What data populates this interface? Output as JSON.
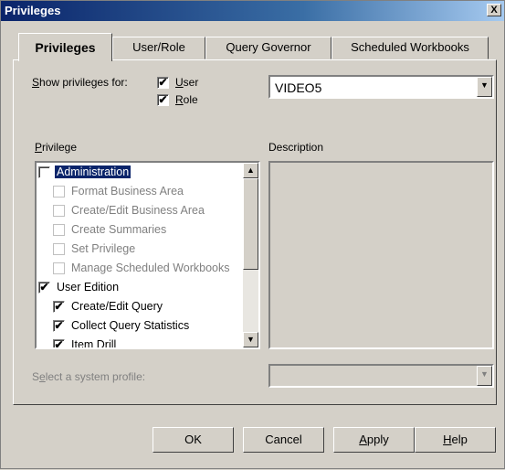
{
  "window": {
    "title": "Privileges",
    "close_label": "X"
  },
  "tabs": [
    {
      "label": "Privileges"
    },
    {
      "label": "User/Role"
    },
    {
      "label": "Query Governor"
    },
    {
      "label": "Scheduled Workbooks"
    }
  ],
  "show_for": {
    "label": "Show privileges for:",
    "user_label": "User",
    "user_checked": true,
    "role_label": "Role",
    "role_checked": true
  },
  "user_combo": {
    "value": "VIDEO5"
  },
  "privilege_list": {
    "label": "Privilege",
    "items": [
      {
        "label": "Administration",
        "checked": false,
        "indent": 0,
        "disabled": false,
        "selected": true
      },
      {
        "label": "Format Business Area",
        "checked": false,
        "indent": 1,
        "disabled": true,
        "selected": false
      },
      {
        "label": "Create/Edit Business Area",
        "checked": false,
        "indent": 1,
        "disabled": true,
        "selected": false
      },
      {
        "label": "Create Summaries",
        "checked": false,
        "indent": 1,
        "disabled": true,
        "selected": false
      },
      {
        "label": "Set Privilege",
        "checked": false,
        "indent": 1,
        "disabled": true,
        "selected": false
      },
      {
        "label": "Manage Scheduled Workbooks",
        "checked": false,
        "indent": 1,
        "disabled": true,
        "selected": false
      },
      {
        "label": "User Edition",
        "checked": true,
        "indent": 0,
        "disabled": false,
        "selected": false
      },
      {
        "label": "Create/Edit Query",
        "checked": true,
        "indent": 1,
        "disabled": false,
        "selected": false
      },
      {
        "label": "Collect Query Statistics",
        "checked": true,
        "indent": 1,
        "disabled": false,
        "selected": false
      },
      {
        "label": "Item Drill",
        "checked": true,
        "indent": 1,
        "disabled": false,
        "selected": false
      }
    ]
  },
  "description": {
    "label": "Description",
    "text": ""
  },
  "system_profile": {
    "label": "Select a system profile:",
    "value": ""
  },
  "buttons": {
    "ok": "OK",
    "cancel": "Cancel",
    "apply": "Apply",
    "help": "Help"
  },
  "icons": {
    "check": "✔",
    "up": "▲",
    "down": "▼"
  }
}
